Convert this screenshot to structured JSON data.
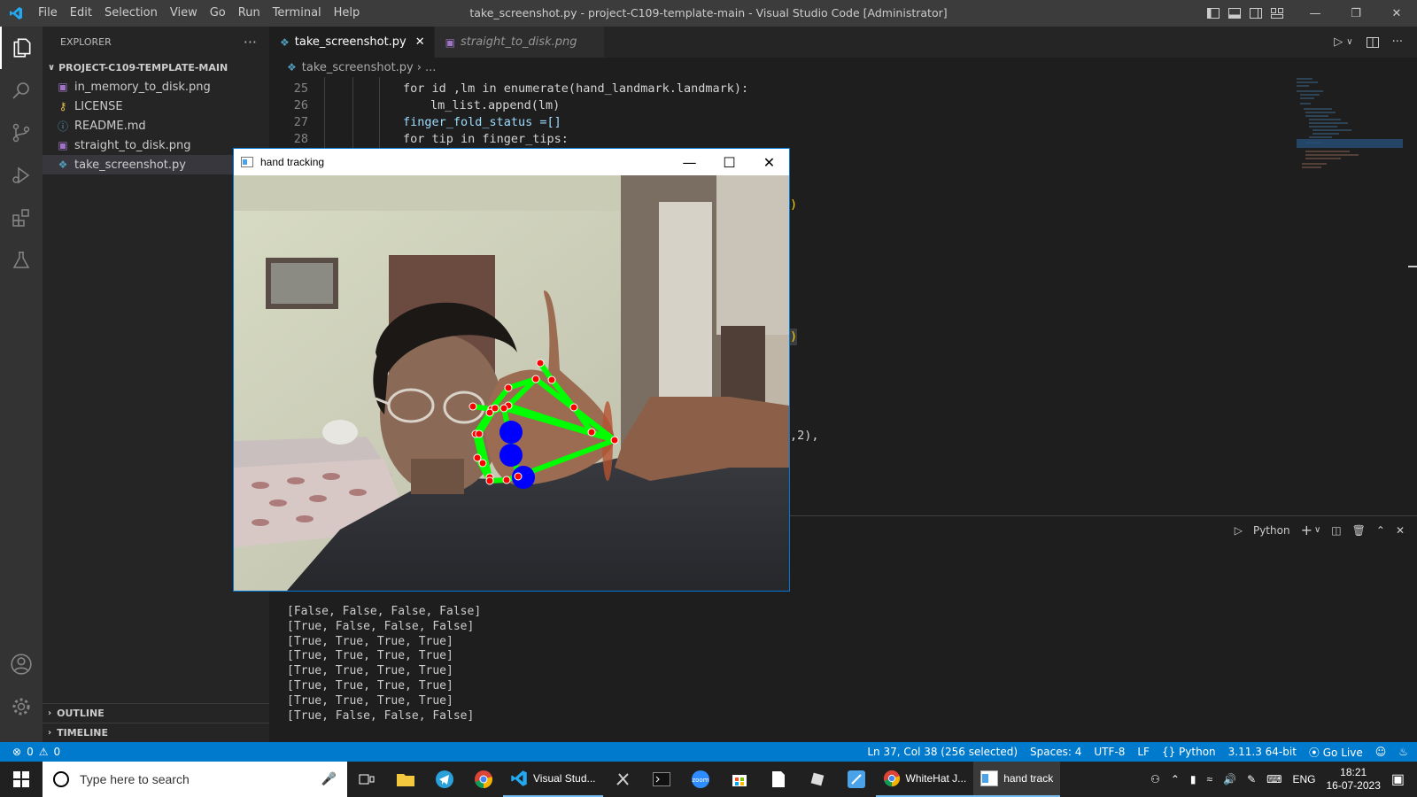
{
  "window": {
    "title": "take_screenshot.py - project-C109-template-main - Visual Studio Code [Administrator]",
    "menu": [
      "File",
      "Edit",
      "Selection",
      "View",
      "Go",
      "Run",
      "Terminal",
      "Help"
    ]
  },
  "sidebar": {
    "header": "EXPLORER",
    "more": "···",
    "project": "PROJECT-C109-TEMPLATE-MAIN",
    "files": [
      {
        "name": "in_memory_to_disk.png",
        "icon": "image-file-icon"
      },
      {
        "name": "LICENSE",
        "icon": "license-file-icon"
      },
      {
        "name": "README.md",
        "icon": "info-file-icon"
      },
      {
        "name": "straight_to_disk.png",
        "icon": "image-file-icon"
      },
      {
        "name": "take_screenshot.py",
        "icon": "python-file-icon"
      }
    ],
    "outline": "OUTLINE",
    "timeline": "TIMELINE"
  },
  "tabs": [
    {
      "label": "take_screenshot.py",
      "active": true
    },
    {
      "label": "straight_to_disk.png",
      "active": false
    }
  ],
  "breadcrumb": {
    "file": "take_screenshot.py",
    "rest": "..."
  },
  "code": {
    "lines": [
      {
        "n": "25",
        "text": "for id ,lm in enumerate(hand_landmark.landmark):"
      },
      {
        "n": "26",
        "text": "lm_list.append(lm)"
      },
      {
        "n": "27",
        "text": "finger_fold_status =[]"
      },
      {
        "n": "28",
        "text": "for tip in finger_tips:"
      }
    ],
    "fragments": [
      ")",
      ")",
      ",2),"
    ]
  },
  "panel": {
    "shell": "Python",
    "output": [
      "[False, False, False, False]",
      "[True, False, False, False]",
      "[True, True, True, True]",
      "[True, True, True, True]",
      "[True, True, True, True]",
      "[True, True, True, True]",
      "[True, True, True, True]",
      "[True, False, False, False]"
    ]
  },
  "statusbar": {
    "errors": "0",
    "warnings": "0",
    "position": "Ln 37, Col 38 (256 selected)",
    "spaces": "Spaces: 4",
    "encoding": "UTF-8",
    "eol": "LF",
    "language": "Python",
    "interpreter": "3.11.3 64-bit",
    "golive": "Go Live"
  },
  "hand_window": {
    "title": "hand tracking"
  },
  "taskbar": {
    "search_placeholder": "Type here to search",
    "apps": [
      "Visual Stud...",
      "WhiteHat J...",
      "hand track"
    ],
    "language": "ENG",
    "time": "18:21",
    "date": "16-07-2023"
  },
  "colors": {
    "accent": "#007acc",
    "landmark_line": "#00ff00",
    "landmark_point": "#ff0000",
    "fold_marker": "#0000ff"
  }
}
